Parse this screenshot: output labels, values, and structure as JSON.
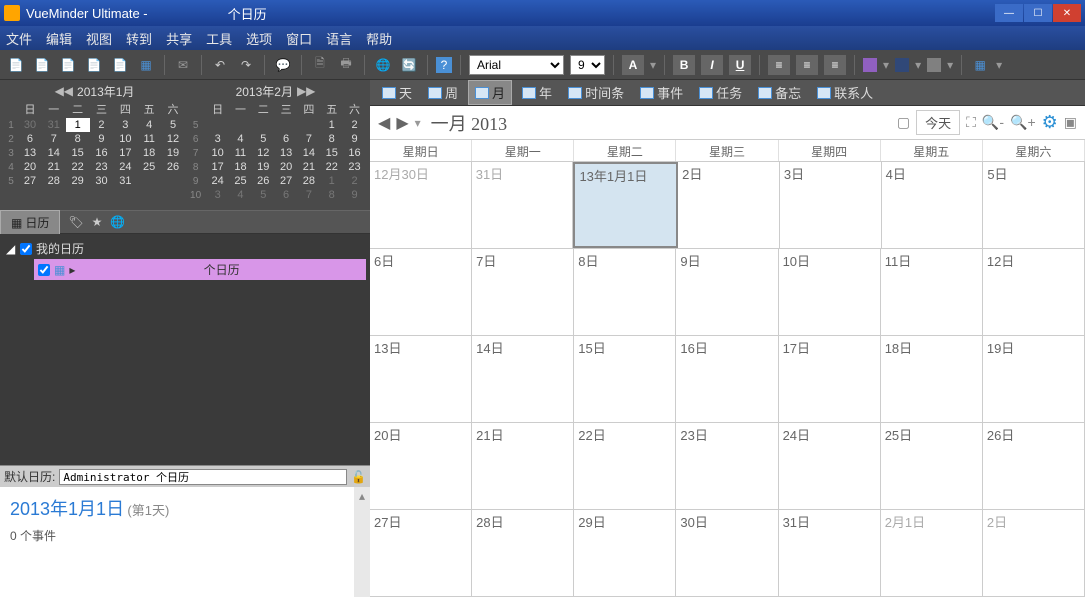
{
  "title": {
    "app": "VueMinder Ultimate -",
    "doc": "个日历"
  },
  "menu": [
    "文件",
    "编辑",
    "视图",
    "转到",
    "共享",
    "工具",
    "选项",
    "窗口",
    "语言",
    "帮助"
  ],
  "toolbar": {
    "font": "Arial",
    "size": "9",
    "fmt": {
      "b": "B",
      "i": "I",
      "u": "U",
      "a": "A"
    }
  },
  "viewtabs": [
    {
      "label": "天"
    },
    {
      "label": "周"
    },
    {
      "label": "月",
      "active": true
    },
    {
      "label": "年"
    },
    {
      "label": "时间条"
    },
    {
      "label": "事件"
    },
    {
      "label": "任务"
    },
    {
      "label": "备忘"
    },
    {
      "label": "联系人"
    }
  ],
  "calheader": {
    "month": "一月 2013",
    "today": "今天"
  },
  "dayheaders": [
    "星期日",
    "星期一",
    "星期二",
    "星期三",
    "星期四",
    "星期五",
    "星期六"
  ],
  "grid": [
    [
      {
        "t": "12月30日",
        "dim": true
      },
      {
        "t": "31日",
        "dim": true
      },
      {
        "t": "13年1月1日",
        "today": true
      },
      {
        "t": "2日"
      },
      {
        "t": "3日"
      },
      {
        "t": "4日"
      },
      {
        "t": "5日"
      }
    ],
    [
      {
        "t": "6日"
      },
      {
        "t": "7日"
      },
      {
        "t": "8日"
      },
      {
        "t": "9日"
      },
      {
        "t": "10日"
      },
      {
        "t": "11日"
      },
      {
        "t": "12日"
      }
    ],
    [
      {
        "t": "13日"
      },
      {
        "t": "14日"
      },
      {
        "t": "15日"
      },
      {
        "t": "16日"
      },
      {
        "t": "17日"
      },
      {
        "t": "18日"
      },
      {
        "t": "19日"
      }
    ],
    [
      {
        "t": "20日"
      },
      {
        "t": "21日"
      },
      {
        "t": "22日"
      },
      {
        "t": "23日"
      },
      {
        "t": "24日"
      },
      {
        "t": "25日"
      },
      {
        "t": "26日"
      }
    ],
    [
      {
        "t": "27日"
      },
      {
        "t": "28日"
      },
      {
        "t": "29日"
      },
      {
        "t": "30日"
      },
      {
        "t": "31日"
      },
      {
        "t": "2月1日",
        "dim": true
      },
      {
        "t": "2日",
        "dim": true
      }
    ]
  ],
  "minicals": [
    {
      "title": "2013年1月",
      "dow": [
        "日",
        "一",
        "二",
        "三",
        "四",
        "五",
        "六"
      ],
      "rows": [
        {
          "wk": "1",
          "d": [
            {
              "t": "30",
              "dim": true
            },
            {
              "t": "31",
              "dim": true
            },
            {
              "t": "1",
              "today": true
            },
            {
              "t": "2"
            },
            {
              "t": "3"
            },
            {
              "t": "4"
            },
            {
              "t": "5"
            }
          ]
        },
        {
          "wk": "2",
          "d": [
            {
              "t": "6"
            },
            {
              "t": "7"
            },
            {
              "t": "8"
            },
            {
              "t": "9"
            },
            {
              "t": "10"
            },
            {
              "t": "11"
            },
            {
              "t": "12"
            }
          ]
        },
        {
          "wk": "3",
          "d": [
            {
              "t": "13"
            },
            {
              "t": "14"
            },
            {
              "t": "15"
            },
            {
              "t": "16"
            },
            {
              "t": "17"
            },
            {
              "t": "18"
            },
            {
              "t": "19"
            }
          ]
        },
        {
          "wk": "4",
          "d": [
            {
              "t": "20"
            },
            {
              "t": "21"
            },
            {
              "t": "22"
            },
            {
              "t": "23"
            },
            {
              "t": "24"
            },
            {
              "t": "25"
            },
            {
              "t": "26"
            }
          ]
        },
        {
          "wk": "5",
          "d": [
            {
              "t": "27"
            },
            {
              "t": "28"
            },
            {
              "t": "29"
            },
            {
              "t": "30"
            },
            {
              "t": "31"
            },
            {
              "t": "",
              "dim": true
            },
            {
              "t": "",
              "dim": true
            }
          ]
        }
      ]
    },
    {
      "title": "2013年2月",
      "dow": [
        "日",
        "一",
        "二",
        "三",
        "四",
        "五",
        "六"
      ],
      "rows": [
        {
          "wk": "5",
          "d": [
            {
              "t": "",
              "dim": true
            },
            {
              "t": "",
              "dim": true
            },
            {
              "t": "",
              "dim": true
            },
            {
              "t": "",
              "dim": true
            },
            {
              "t": "",
              "dim": true
            },
            {
              "t": "1"
            },
            {
              "t": "2"
            }
          ]
        },
        {
          "wk": "6",
          "d": [
            {
              "t": "3"
            },
            {
              "t": "4"
            },
            {
              "t": "5"
            },
            {
              "t": "6"
            },
            {
              "t": "7"
            },
            {
              "t": "8"
            },
            {
              "t": "9"
            }
          ]
        },
        {
          "wk": "7",
          "d": [
            {
              "t": "10"
            },
            {
              "t": "11"
            },
            {
              "t": "12"
            },
            {
              "t": "13"
            },
            {
              "t": "14"
            },
            {
              "t": "15"
            },
            {
              "t": "16"
            }
          ]
        },
        {
          "wk": "8",
          "d": [
            {
              "t": "17"
            },
            {
              "t": "18"
            },
            {
              "t": "19"
            },
            {
              "t": "20"
            },
            {
              "t": "21"
            },
            {
              "t": "22"
            },
            {
              "t": "23"
            }
          ]
        },
        {
          "wk": "9",
          "d": [
            {
              "t": "24"
            },
            {
              "t": "25"
            },
            {
              "t": "26"
            },
            {
              "t": "27"
            },
            {
              "t": "28"
            },
            {
              "t": "1",
              "dim": true
            },
            {
              "t": "2",
              "dim": true
            }
          ]
        },
        {
          "wk": "10",
          "d": [
            {
              "t": "3",
              "dim": true
            },
            {
              "t": "4",
              "dim": true
            },
            {
              "t": "5",
              "dim": true
            },
            {
              "t": "6",
              "dim": true
            },
            {
              "t": "7",
              "dim": true
            },
            {
              "t": "8",
              "dim": true
            },
            {
              "t": "9",
              "dim": true
            }
          ]
        }
      ]
    }
  ],
  "caltab": "日历",
  "tree": {
    "root": "我的日历",
    "child": "个日历"
  },
  "defaultcal": {
    "label": "默认日历:",
    "value": "Administrator 个日历"
  },
  "detail": {
    "date": "2013年1月1日",
    "day": "(第1天)",
    "events": "0 个事件"
  }
}
